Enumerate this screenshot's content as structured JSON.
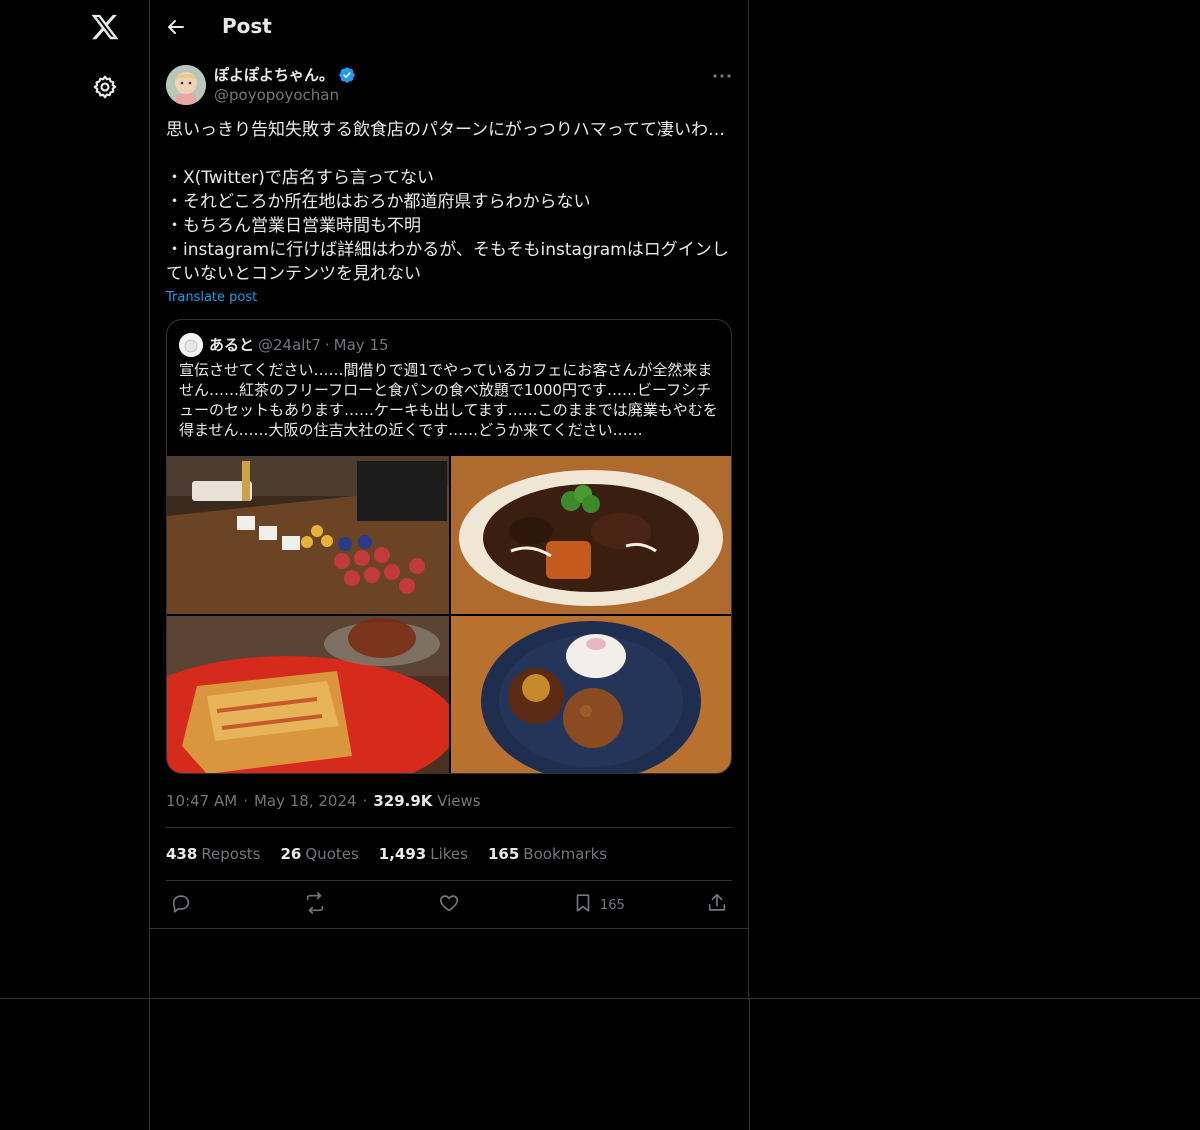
{
  "nav": {
    "logo": "x-logo",
    "settings": "gear-icon"
  },
  "header": {
    "title": "Post"
  },
  "post": {
    "author_name": "ぽよぽよちゃん。",
    "author_handle": "@poyopoyochan",
    "text": "思いっきり告知失敗する飲食店のパターンにがっつりハマってて凄いわ…\n\n・X(Twitter)で店名すら言ってない\n・それどころか所在地はおろか都道府県すらわからない\n・もちろん営業日営業時間も不明\n・instagramに行けば詳細はわかるが、そもそもinstagramはログインしていないとコンテンツを見れない",
    "translate_label": "Translate post",
    "time": "10:47 AM",
    "date": "May 18, 2024",
    "views_count": "329.9K",
    "views_label": "Views"
  },
  "quote": {
    "author_name": "あると",
    "author_handle": "@24alt7",
    "separator": "·",
    "date": "May 15",
    "text": "宣伝させてください……間借りで週1でやっているカフェにお客さんが全然来ません……紅茶のフリーフローと食パンの食べ放題で1000円です……ビーフシチューのセットもあります……ケーキも出してます……このままでは廃業もやむを得ません……大阪の住吉大社の近くです……どうか来てください……"
  },
  "stats": [
    {
      "count": "438",
      "label": "Reposts"
    },
    {
      "count": "26",
      "label": "Quotes"
    },
    {
      "count": "1,493",
      "label": "Likes"
    },
    {
      "count": "165",
      "label": "Bookmarks"
    }
  ],
  "actions": {
    "bookmark_count": "165"
  },
  "separator": "·"
}
